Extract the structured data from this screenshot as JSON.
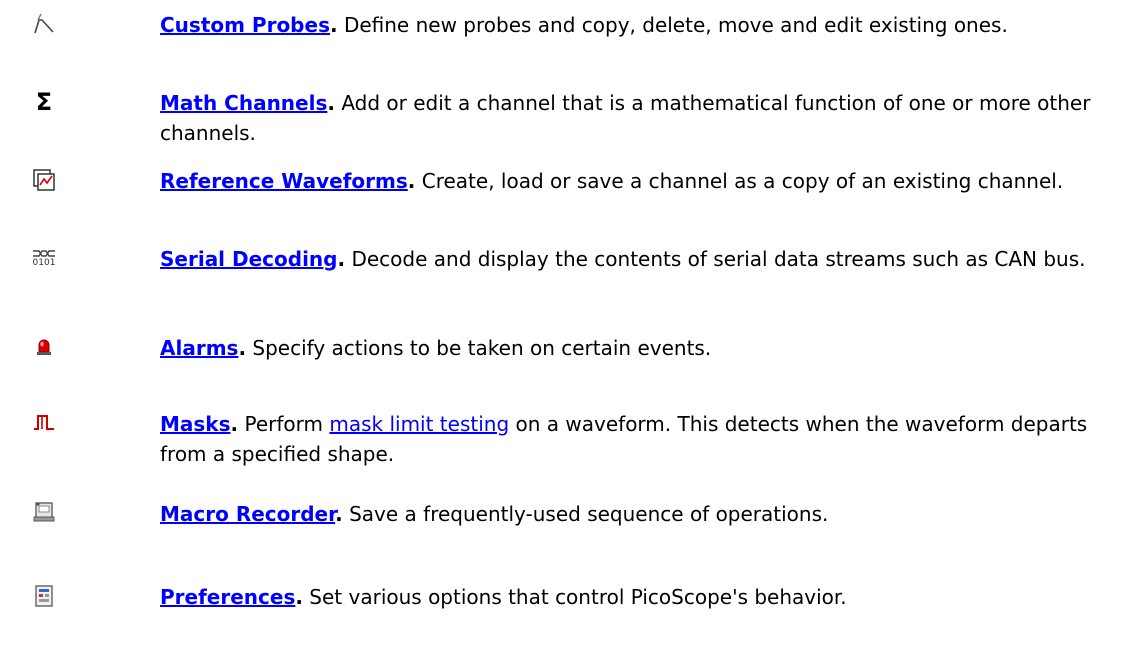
{
  "items": [
    {
      "icon": "custom-probe-icon",
      "title": "Custom Probes",
      "desc": " Define new probes and copy, delete, move and edit existing ones."
    },
    {
      "icon": "sigma-icon",
      "title": "Math Channels",
      "desc": " Add or edit a channel that is a mathematical function of one or more other channels."
    },
    {
      "icon": "reference-waveform-icon",
      "title": "Reference Waveforms",
      "desc": " Create, load or save a channel as a copy of an existing channel."
    },
    {
      "icon": "serial-decoding-icon",
      "title": "Serial Decoding",
      "desc": " Decode and display the contents of serial data streams such as CAN bus."
    },
    {
      "icon": "alarm-light-icon",
      "title": "Alarms",
      "desc": " Specify actions to be taken on certain events."
    },
    {
      "icon": "mask-pulse-icon",
      "title": "Masks",
      "desc_pre": " Perform ",
      "link": "mask limit testing",
      "desc_post": " on a waveform. This detects when the waveform departs from a specified shape."
    },
    {
      "icon": "macro-recorder-icon",
      "title": "Macro Recorder",
      "desc": " Save a frequently-used sequence of operations."
    },
    {
      "icon": "preferences-icon",
      "title": "Preferences",
      "desc": " Set various options that control PicoScope's behavior."
    }
  ],
  "punct": {
    "dot": "."
  },
  "icon_glyphs": {
    "sigma": "Σ",
    "binary": "0101"
  }
}
